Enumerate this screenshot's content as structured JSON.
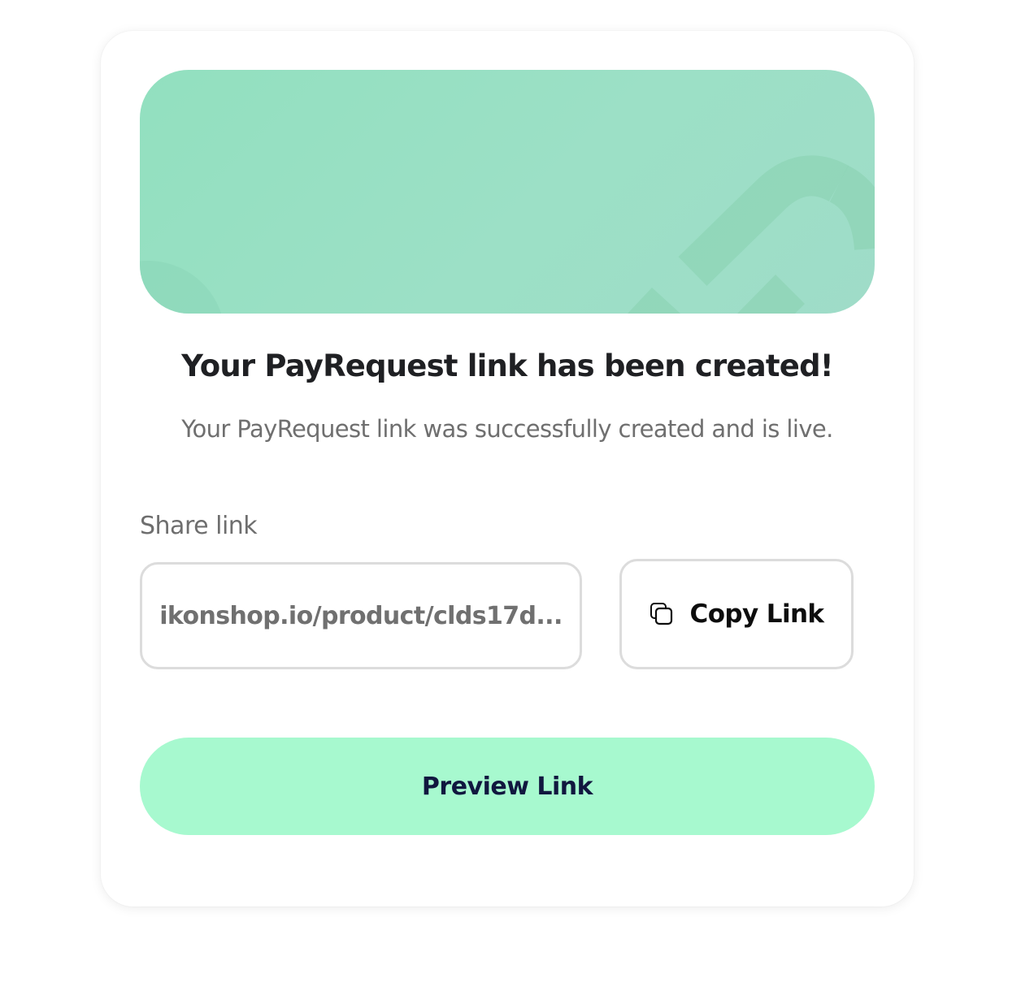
{
  "dialog": {
    "title": "Your PayRequest link has been created!",
    "subtitle": "Your PayRequest link was successfully created and is live."
  },
  "share": {
    "label": "Share link",
    "link_value": "ikonshop.io/product/clds17d...",
    "copy_label": "Copy Link",
    "copy_icon": "copy-icon"
  },
  "actions": {
    "preview_label": "Preview Link"
  },
  "colors": {
    "banner": "#9ce0c6",
    "preview_button": "#a7f9cf",
    "preview_text": "#11173f",
    "border": "#dcdcdc"
  }
}
